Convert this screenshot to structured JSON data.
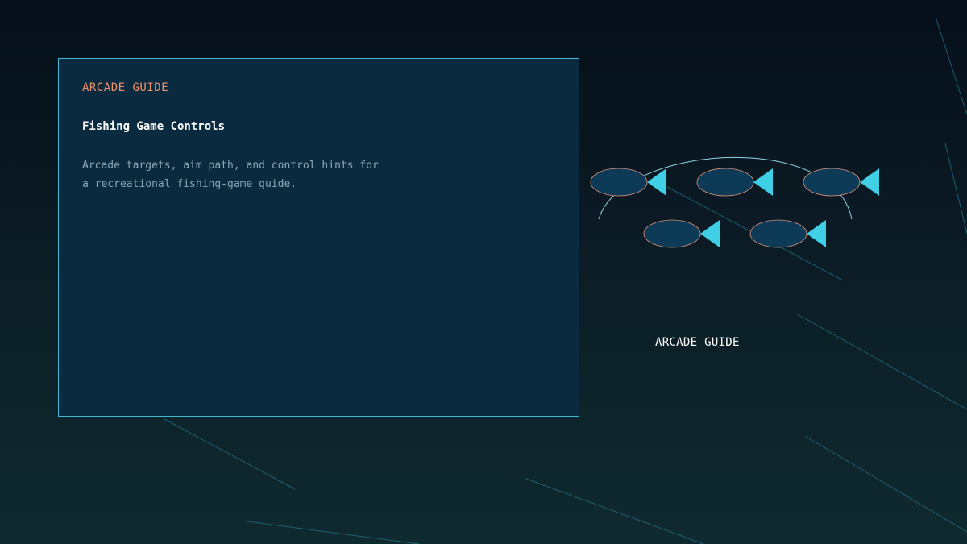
{
  "panel": {
    "eyebrow": "ARCADE GUIDE",
    "title": "Fishing Game Controls",
    "description": "Arcade targets, aim path, and control hints for a recreational fishing-game guide."
  },
  "scene": {
    "caption": "ARCADE GUIDE",
    "fish_count": 5
  },
  "colors": {
    "accent": "#f2906a",
    "panel_border": "#3fb8d6",
    "fish_body": "#0d3a57",
    "fish_tail": "#3fd0e6",
    "aim_path": "#8fd6e8"
  }
}
